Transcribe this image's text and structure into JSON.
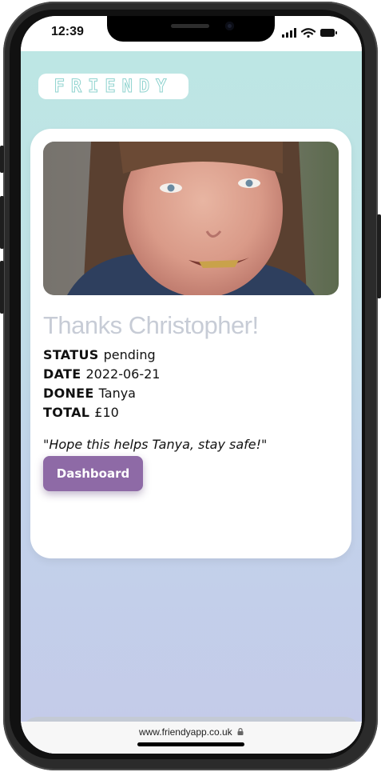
{
  "status_bar": {
    "time": "12:39"
  },
  "app": {
    "logo_text": "FRIENDY",
    "heading": "Thanks Christopher!",
    "details": [
      {
        "label": "STATUS",
        "value": "pending"
      },
      {
        "label": "DATE",
        "value": "2022-06-21"
      },
      {
        "label": "DONEE",
        "value": "Tanya"
      },
      {
        "label": "TOTAL",
        "value": "£10"
      }
    ],
    "message": "\"Hope this helps Tanya, stay safe!\"",
    "dashboard_button": "Dashboard"
  },
  "bottom_nav": {
    "icons": [
      "pie-chart-icon",
      "rainbow-icon",
      "hamburger-menu-icon"
    ]
  },
  "browser": {
    "url": "www.friendyapp.co.uk"
  },
  "colors": {
    "accent_button": "#8e6aa6",
    "background_top": "#bde6e4",
    "background_bottom": "#c4cae9",
    "heading": "#c7ccd6"
  }
}
